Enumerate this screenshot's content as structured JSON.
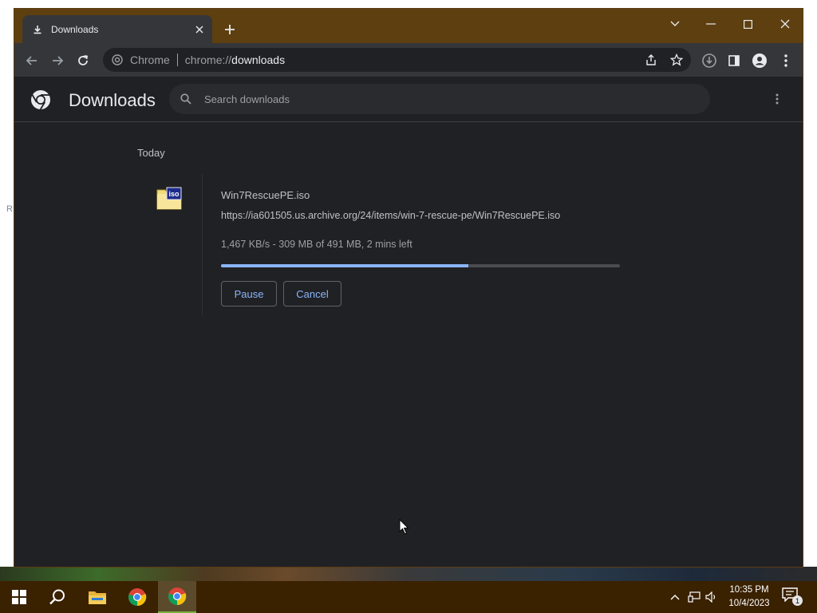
{
  "browser": {
    "tab": {
      "title": "Downloads"
    },
    "omnibox": {
      "chip_label": "Chrome",
      "url_scheme": "chrome://",
      "url_host": "downloads"
    }
  },
  "page": {
    "title": "Downloads",
    "search_placeholder": "Search downloads",
    "date_header": "Today"
  },
  "download": {
    "file_icon_label": "iso",
    "file_name": "Win7RescuePE.iso",
    "url": "https://ia601505.us.archive.org/24/items/win-7-rescue-pe/Win7RescuePE.iso",
    "status": "1,467 KB/s - 309 MB of 491 MB, 2 mins left",
    "progress_fraction": 0.62,
    "pause_label": "Pause",
    "cancel_label": "Cancel"
  },
  "taskbar": {
    "time": "10:35 PM",
    "date": "10/4/2023",
    "notification_count": "1"
  },
  "desktop": {
    "edge_letter": "R"
  },
  "colors": {
    "accent": "#8ab4f8",
    "titlebar": "#5e3f10",
    "taskbar": "#3a2100",
    "page_bg": "#202124"
  }
}
